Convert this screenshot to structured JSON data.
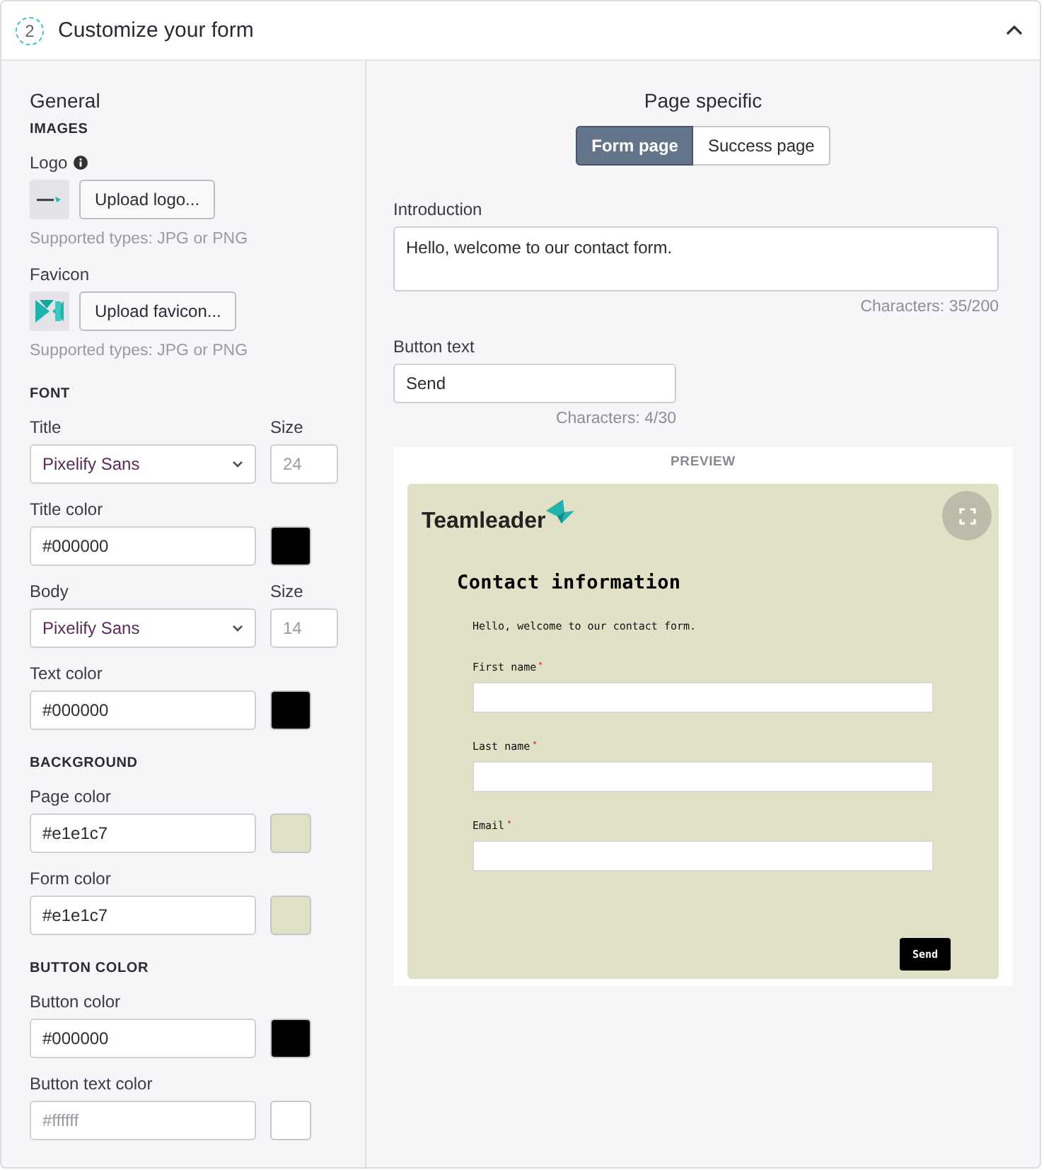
{
  "section": {
    "step": "2",
    "title": "Customize your form",
    "expanded": true
  },
  "general": {
    "heading": "General",
    "groups": [
      {
        "title": "IMAGES",
        "fields": [
          {
            "kind": "logo",
            "label": "Logo",
            "info": true,
            "button": "Upload logo...",
            "hint": "Supported types: JPG or PNG"
          },
          {
            "kind": "favicon",
            "label": "Favicon",
            "info": false,
            "button": "Upload favicon...",
            "hint": "Supported types: JPG or PNG"
          }
        ]
      },
      {
        "title": "FONT",
        "fields": [
          {
            "kind": "font",
            "label": "Title",
            "value": "Pixelify Sans",
            "size_label": "Size",
            "size_placeholder": "24"
          },
          {
            "kind": "color",
            "label": "Title color",
            "value": "#000000",
            "color": "#000000"
          },
          {
            "kind": "font",
            "label": "Body",
            "value": "Pixelify Sans",
            "size_label": "Size",
            "size_placeholder": "14"
          },
          {
            "kind": "color",
            "label": "Text color",
            "value": "#000000",
            "color": "#000000"
          }
        ]
      },
      {
        "title": "BACKGROUND",
        "fields": [
          {
            "kind": "color",
            "label": "Page color",
            "value": "#e1e1c7",
            "color": "#e1e1c7"
          },
          {
            "kind": "color",
            "label": "Form color",
            "value": "#e1e1c7",
            "color": "#e1e1c7"
          }
        ]
      },
      {
        "title": "BUTTON COLOR",
        "fields": [
          {
            "kind": "color",
            "label": "Button color",
            "value": "#000000",
            "color": "#000000"
          },
          {
            "kind": "color",
            "label": "Button text color",
            "placeholder": "#ffffff",
            "color": "#ffffff"
          }
        ]
      }
    ]
  },
  "page_specific": {
    "heading": "Page specific",
    "tabs": [
      {
        "label": "Form page",
        "selected": true
      },
      {
        "label": "Success page",
        "selected": false
      }
    ],
    "introduction": {
      "label": "Introduction",
      "value": "Hello, welcome to our contact form.",
      "counter": "Characters: 35/200"
    },
    "button_text": {
      "label": "Button text",
      "value": "Send",
      "counter": "Characters: 4/30"
    },
    "preview": {
      "label": "PREVIEW",
      "brand": "Teamleader",
      "title": "Contact information",
      "intro": "Hello, welcome to our contact form.",
      "fields": [
        {
          "label": "First name",
          "required": true
        },
        {
          "label": "Last name",
          "required": true
        },
        {
          "label": "Email",
          "required": true
        }
      ],
      "button": "Send"
    }
  }
}
